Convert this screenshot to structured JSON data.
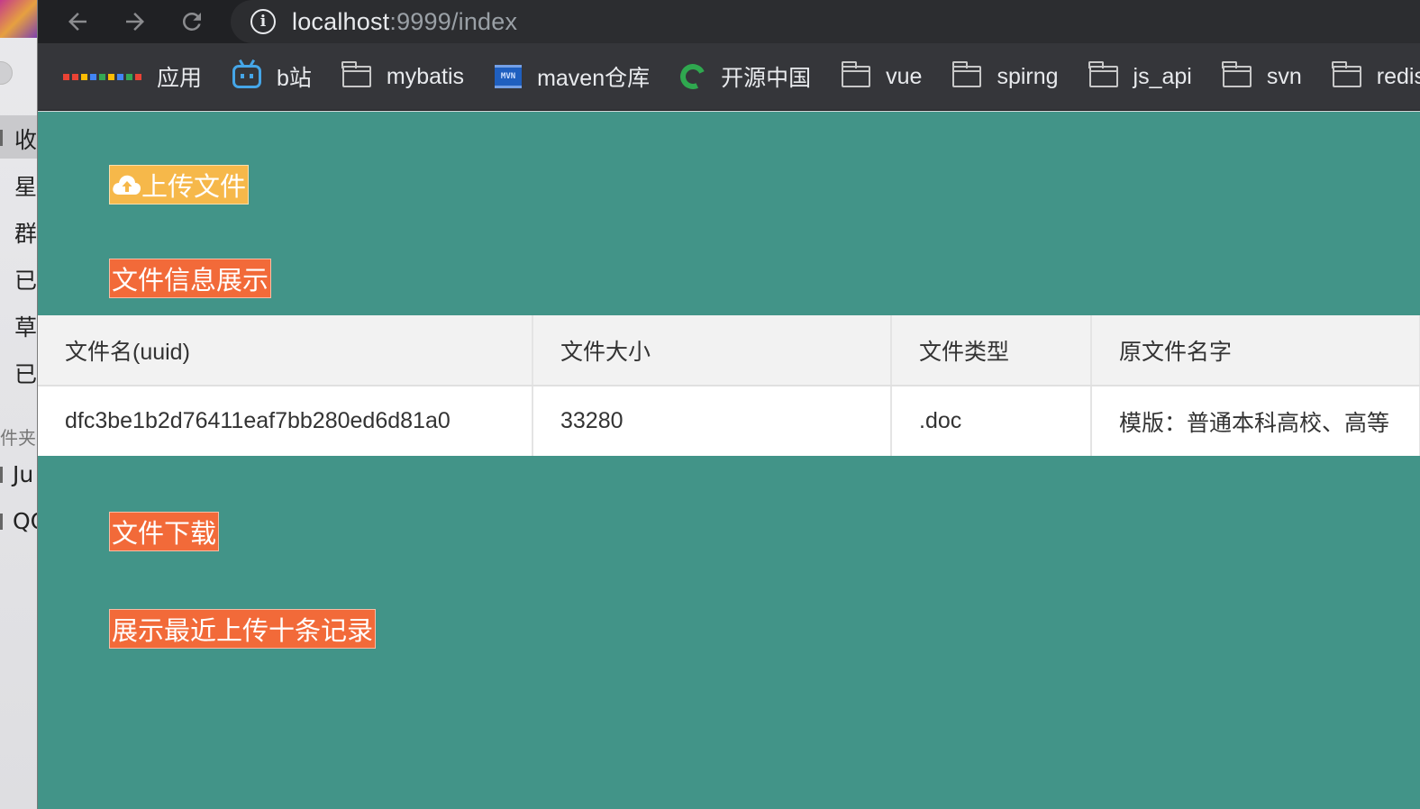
{
  "sidebar": {
    "items": [
      "收",
      "星",
      "群",
      "已",
      "草",
      "已"
    ],
    "section": "件夹",
    "items2": [
      "Ju",
      "QQ"
    ]
  },
  "browser": {
    "url_host": "localhost",
    "url_rest": ":9999/index"
  },
  "bookmarks": [
    {
      "label": "应用",
      "icon": "apps-grid-icon"
    },
    {
      "label": "b站",
      "icon": "bilibili-icon"
    },
    {
      "label": "mybatis",
      "icon": "folder-icon"
    },
    {
      "label": "maven仓库",
      "icon": "maven-icon"
    },
    {
      "label": "开源中国",
      "icon": "oschina-icon"
    },
    {
      "label": "vue",
      "icon": "folder-icon"
    },
    {
      "label": "spirng",
      "icon": "folder-icon"
    },
    {
      "label": "js_api",
      "icon": "folder-icon"
    },
    {
      "label": "svn",
      "icon": "folder-icon"
    },
    {
      "label": "redis",
      "icon": "folder-icon"
    }
  ],
  "page": {
    "upload_label": "上传文件",
    "info_label": "文件信息展示",
    "download_label": "文件下载",
    "recent_label": "展示最近上传十条记录",
    "colors": {
      "background": "#429488",
      "upload": "#f6b84a",
      "action": "#f26a39"
    }
  },
  "table": {
    "headers": [
      "文件名(uuid)",
      "文件大小",
      "文件类型",
      "原文件名字"
    ],
    "rows": [
      [
        "dfc3be1b2d76411eaf7bb280ed6d81a0",
        "33280",
        ".doc",
        "模版：普通本科高校、高等"
      ]
    ]
  }
}
